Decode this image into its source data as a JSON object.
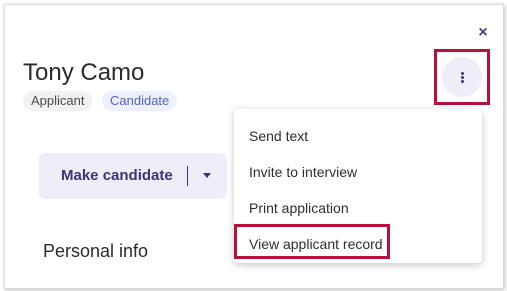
{
  "header": {
    "close_label": "×",
    "name": "Tony Camo",
    "tags": [
      "Applicant",
      "Candidate"
    ]
  },
  "actions": {
    "make_candidate_label": "Make candidate"
  },
  "sections": {
    "personal_info": "Personal info"
  },
  "menu": {
    "items": [
      "Send text",
      "Invite to interview",
      "Print application",
      "View applicant record"
    ]
  },
  "icons": {
    "close": "close-icon",
    "more": "kebab-vertical-icon",
    "dropdown": "chevron-down-icon"
  },
  "colors": {
    "accent": "#4a3a8f",
    "highlight": "#b5113b",
    "candidate_tag": "#5264c8"
  }
}
